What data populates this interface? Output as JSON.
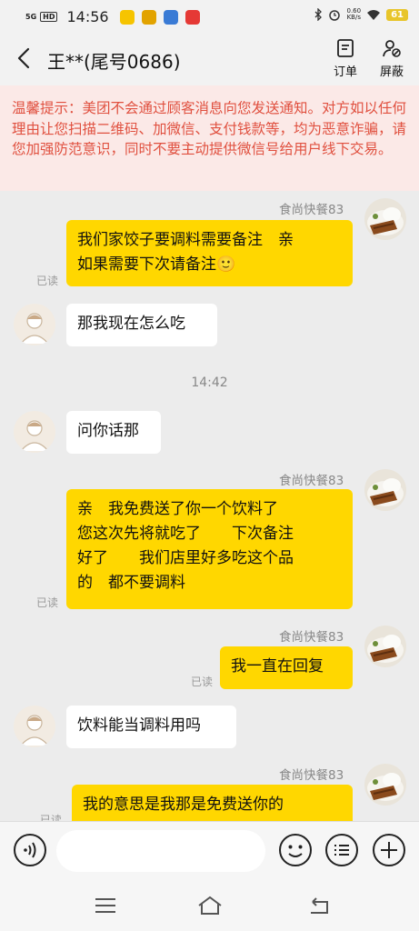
{
  "status_bar": {
    "network": "5G",
    "hd": "HD",
    "time": "14:56",
    "speed_value": "0.60",
    "speed_unit": "KB/s",
    "battery": "61"
  },
  "header": {
    "title": "王**(尾号0686)",
    "order_label": "订单",
    "block_label": "屏蔽"
  },
  "notice": {
    "text": "温馨提示：美团不会通过顾客消息向您发送通知。对方如以任何理由让您扫描二维码、加微信、支付钱款等，均为恶意诈骗，请您加强防范意识，同时不要主动提供微信号给用户线下交易。"
  },
  "messages": [
    {
      "side": "right",
      "sender": "食尚快餐83",
      "lines": [
        "我们家饺子要调料需要备注　亲",
        "如果需要下次请备注🙂"
      ],
      "read": "已读"
    },
    {
      "side": "left",
      "lines": [
        "那我现在怎么吃"
      ]
    },
    {
      "timestamp": "14:42"
    },
    {
      "side": "left",
      "lines": [
        "问你话那"
      ]
    },
    {
      "side": "right",
      "sender": "食尚快餐83",
      "lines": [
        "亲　我免费送了你一个饮料了",
        "您这次先将就吃了　　下次备注",
        "好了　　我们店里好多吃这个品",
        "的　都不要调料"
      ],
      "read": "已读"
    },
    {
      "side": "right",
      "sender": "食尚快餐83",
      "lines": [
        "我一直在回复"
      ],
      "read": "已读"
    },
    {
      "side": "left",
      "lines": [
        "饮料能当调料用吗"
      ]
    },
    {
      "side": "right",
      "sender": "食尚快餐83",
      "lines": [
        "我的意思是我那是免费送你的"
      ],
      "read": "已读"
    }
  ],
  "colors": {
    "bubble_merchant": "#ffd700",
    "bubble_customer": "#ffffff",
    "notice_text": "#e0503f",
    "notice_bg": "#fbe9e7"
  },
  "icons": [
    "back-arrow-icon",
    "order-icon",
    "block-user-icon",
    "voice-icon",
    "emoji-icon",
    "quick-reply-icon",
    "plus-icon",
    "nav-menu-icon",
    "nav-home-icon",
    "nav-back-icon"
  ]
}
